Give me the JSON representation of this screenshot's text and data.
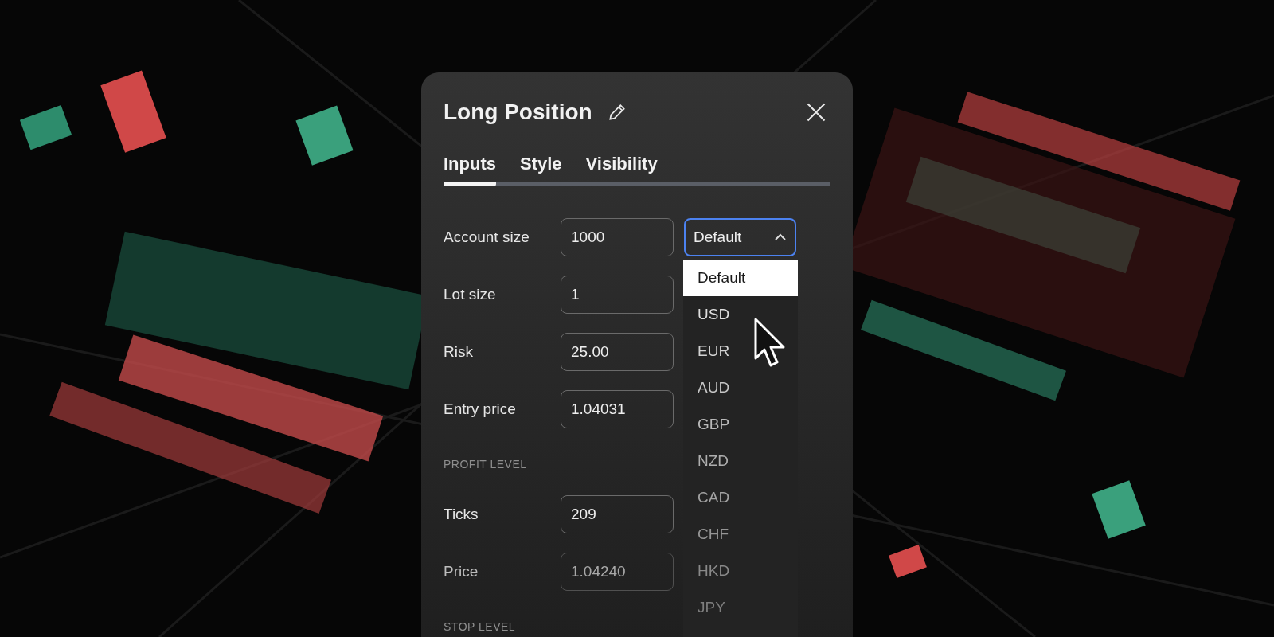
{
  "dialog": {
    "title": "Long Position",
    "tabs": [
      {
        "label": "Inputs",
        "selected": true
      },
      {
        "label": "Style",
        "selected": false
      },
      {
        "label": "Visibility",
        "selected": false
      }
    ],
    "rows": [
      {
        "kind": "field",
        "label": "Account size",
        "value": "1000",
        "disabled": false,
        "select": {
          "value": "Default",
          "open": true
        }
      },
      {
        "kind": "field",
        "label": "Lot size",
        "value": "1",
        "disabled": false
      },
      {
        "kind": "field",
        "label": "Risk",
        "value": "25.00",
        "disabled": false
      },
      {
        "kind": "field",
        "label": "Entry price",
        "value": "1.04031",
        "disabled": false
      },
      {
        "kind": "section",
        "label": "PROFIT LEVEL"
      },
      {
        "kind": "field",
        "label": "Ticks",
        "value": "209",
        "disabled": false
      },
      {
        "kind": "field",
        "label": "Price",
        "value": "1.04240",
        "disabled": true
      },
      {
        "kind": "section",
        "label": "STOP LEVEL"
      }
    ],
    "currency_menu": [
      {
        "label": "Default",
        "selected": true
      },
      {
        "label": "USD",
        "selected": false
      },
      {
        "label": "EUR",
        "selected": false
      },
      {
        "label": "AUD",
        "selected": false
      },
      {
        "label": "GBP",
        "selected": false
      },
      {
        "label": "NZD",
        "selected": false
      },
      {
        "label": "CAD",
        "selected": false
      },
      {
        "label": "CHF",
        "selected": false
      },
      {
        "label": "HKD",
        "selected": false
      },
      {
        "label": "JPY",
        "selected": false
      }
    ]
  }
}
